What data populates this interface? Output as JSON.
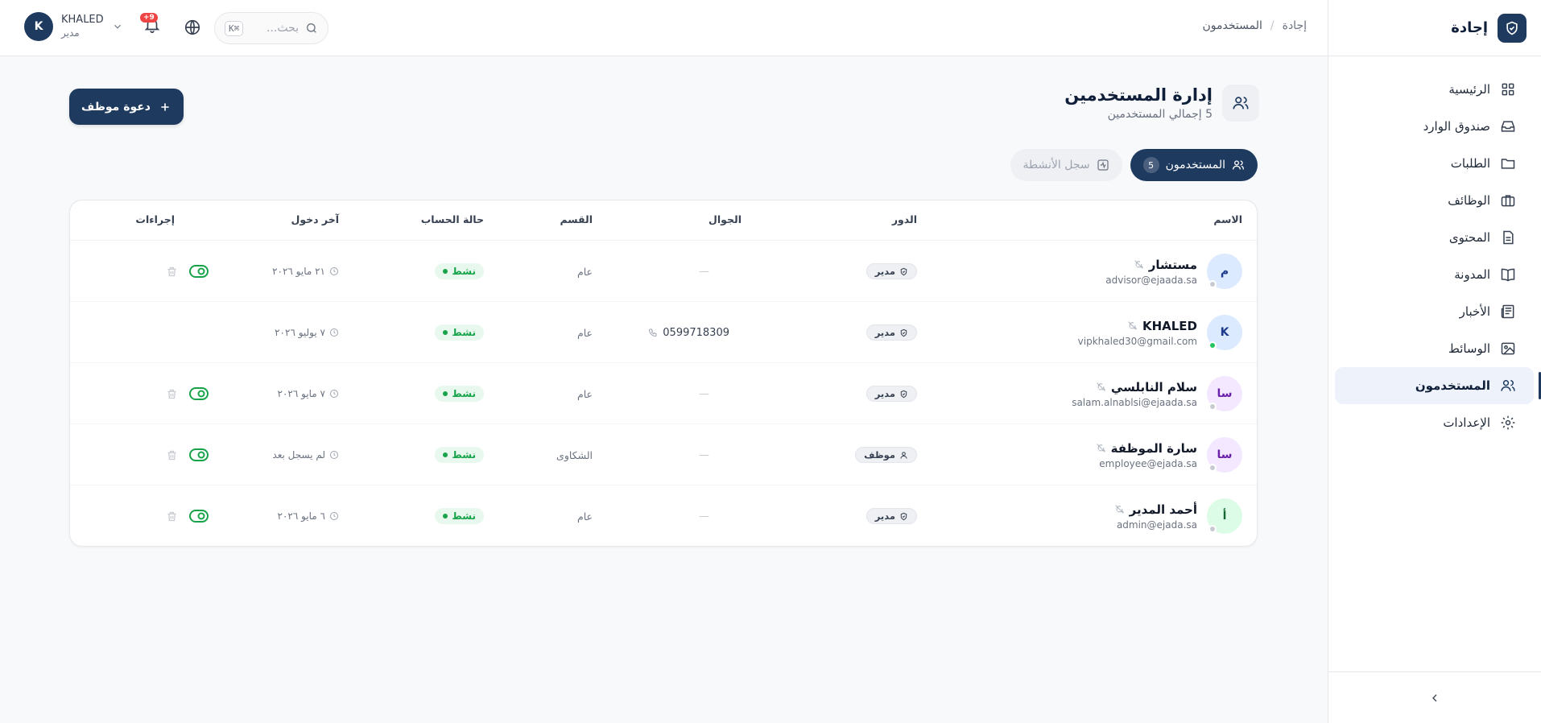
{
  "brand": {
    "name": "إجادة"
  },
  "sidebar": {
    "items": [
      {
        "label": "الرئيسية",
        "icon": "grid-icon"
      },
      {
        "label": "صندوق الوارد",
        "icon": "inbox-icon"
      },
      {
        "label": "الطلبات",
        "icon": "folder-icon"
      },
      {
        "label": "الوظائف",
        "icon": "briefcase-icon"
      },
      {
        "label": "المحتوى",
        "icon": "document-icon"
      },
      {
        "label": "المدونة",
        "icon": "book-icon"
      },
      {
        "label": "الأخبار",
        "icon": "newspaper-icon"
      },
      {
        "label": "الوسائط",
        "icon": "image-icon"
      },
      {
        "label": "المستخدمون",
        "icon": "users-icon",
        "active": true
      },
      {
        "label": "الإعدادات",
        "icon": "gear-icon"
      }
    ]
  },
  "topbar": {
    "breadcrumb": {
      "root": "إجادة",
      "sep": "/",
      "current": "المستخدمون"
    },
    "search_placeholder": "بحث...",
    "search_shortcut": "⌘K",
    "notifications_badge": "9+",
    "user": {
      "initial": "K",
      "name": "KHALED",
      "role": "مدير"
    }
  },
  "page": {
    "title": "إدارة المستخدمين",
    "subtitle": "5 إجمالي المستخدمين",
    "invite_label": "دعوة موظف"
  },
  "tabs": [
    {
      "label": "المستخدمون",
      "count": "5",
      "active": true
    },
    {
      "label": "سجل الأنشطة",
      "active": false
    }
  ],
  "table": {
    "headers": {
      "name": "الاسم",
      "role": "الدور",
      "mobile": "الجوال",
      "department": "القسم",
      "status": "حالة الحساب",
      "last_login": "آخر دخول",
      "actions": "إجراءات"
    },
    "rows": [
      {
        "initial": "م",
        "avatar_bg": "#dbeafe",
        "avatar_fg": "#1e3a8a",
        "online": false,
        "name": "مستشار",
        "email": "advisor@ejaada.sa",
        "role": "مدير",
        "role_icon": "shield-icon",
        "mobile": "—",
        "department": "عام",
        "status": "نشط",
        "last_login": "٢١ مايو ٢٠٢٦",
        "has_actions": true
      },
      {
        "initial": "K",
        "avatar_bg": "#dbeafe",
        "avatar_fg": "#1e3a8a",
        "online": true,
        "name": "KHALED",
        "email": "vipkhaled30@gmail.com",
        "role": "مدير",
        "role_icon": "shield-icon",
        "mobile": "0599718309",
        "department": "عام",
        "status": "نشط",
        "last_login": "٧ يوليو ٢٠٢٦",
        "has_actions": false
      },
      {
        "initial": "سا",
        "avatar_bg": "#f3e8ff",
        "avatar_fg": "#6b21a8",
        "online": false,
        "name": "سلام النابلسي",
        "email": "salam.alnablsi@ejaada.sa",
        "role": "مدير",
        "role_icon": "shield-icon",
        "mobile": "—",
        "department": "عام",
        "status": "نشط",
        "last_login": "٧ مايو ٢٠٢٦",
        "has_actions": true
      },
      {
        "initial": "سا",
        "avatar_bg": "#f3e8ff",
        "avatar_fg": "#6b21a8",
        "online": false,
        "name": "سارة الموظفة",
        "email": "employee@ejada.sa",
        "role": "موظف",
        "role_icon": "user-icon",
        "mobile": "—",
        "department": "الشكاوى",
        "status": "نشط",
        "last_login": "لم يسجل بعد",
        "has_actions": true
      },
      {
        "initial": "أ",
        "avatar_bg": "#dcfce7",
        "avatar_fg": "#166534",
        "online": false,
        "name": "أحمد المدير",
        "email": "admin@ejada.sa",
        "role": "مدير",
        "role_icon": "shield-icon",
        "mobile": "—",
        "department": "عام",
        "status": "نشط",
        "last_login": "٦ مايو ٢٠٢٦",
        "has_actions": true
      }
    ]
  },
  "colors": {
    "primary": "#1e3a5f",
    "active_green": "#16a34a",
    "badge_red": "#ef4444"
  }
}
